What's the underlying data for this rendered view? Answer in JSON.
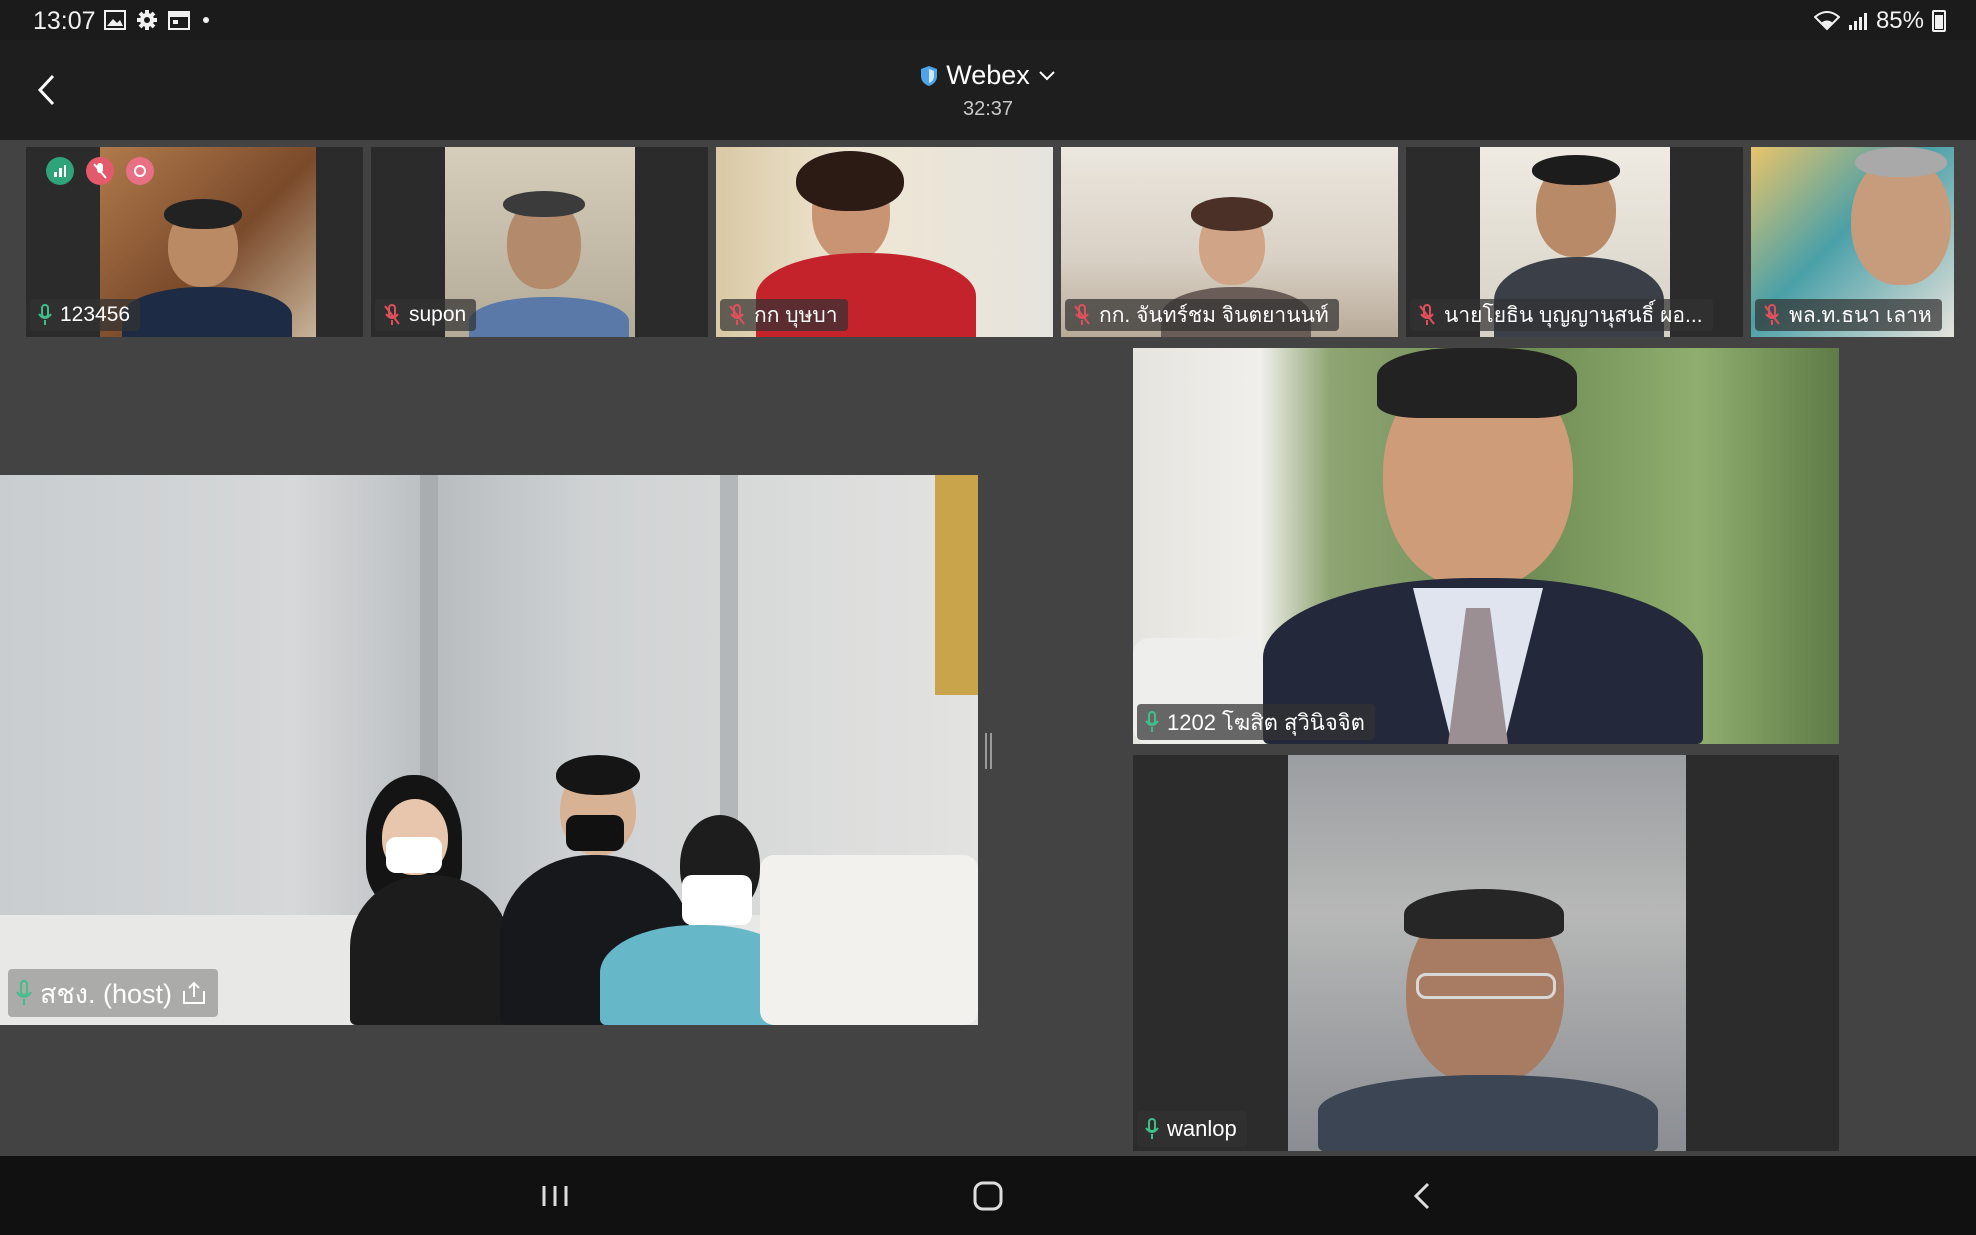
{
  "status_bar": {
    "time": "13:07",
    "battery": "85%",
    "icons": [
      "gallery-icon",
      "settings-icon",
      "calendar-icon",
      "dot-icon",
      "wifi-icon",
      "signal-icon",
      "battery-icon"
    ]
  },
  "header": {
    "app_title": "Webex",
    "meeting_timer": "32:37"
  },
  "thumbnails": [
    {
      "name": "123456",
      "mic": "on"
    },
    {
      "name": "supon",
      "mic": "muted"
    },
    {
      "name": "กก บุษบา",
      "mic": "muted"
    },
    {
      "name": "กก. จันทร์ชม จินตยานนท์",
      "mic": "muted"
    },
    {
      "name": "นายโยธิน บุญญานุสนธิ์ ผอ...",
      "mic": "muted"
    },
    {
      "name": "พล.ท.ธนา เลาห",
      "mic": "muted"
    }
  ],
  "main_tiles": {
    "host": {
      "name": "สชง. (host)",
      "mic": "on",
      "sharing_icon": "share-icon"
    },
    "speaker": {
      "name": "1202 โฆสิต สุวินิจจิต",
      "mic": "on"
    },
    "wanlop": {
      "name": "wanlop",
      "mic": "on"
    }
  },
  "colors": {
    "mic_on": "#3fbf8a",
    "mic_muted": "#e0505c",
    "badge_green": "#2fa37a",
    "badge_red": "#e35a6d",
    "webex_shield": "#4fa3e8"
  }
}
